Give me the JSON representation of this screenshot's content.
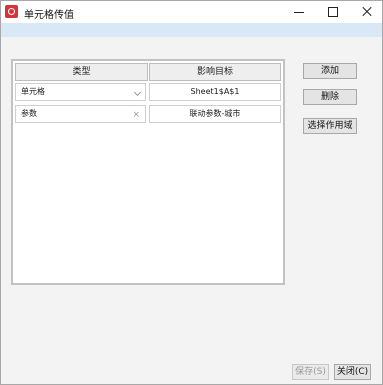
{
  "window": {
    "title": "单元格传值"
  },
  "table": {
    "headers": [
      "类型",
      "影响目标"
    ],
    "rows": [
      {
        "type": "单元格",
        "target": "Sheet1$A$1"
      },
      {
        "type": "参数",
        "target": "联动参数-城市"
      }
    ]
  },
  "side_buttons": {
    "add": "添加",
    "delete": "删除",
    "scope": "选择作用域"
  },
  "footer": {
    "save": "保存(S)",
    "close": "关闭(C)"
  },
  "icons": [
    "app-icon",
    "minimize-icon",
    "maximize-icon",
    "close-icon",
    "dropdown-chevron-icon",
    "clear-icon"
  ],
  "colors": {
    "app_icon": "#d4343a",
    "infobar": "#d9e8f6"
  }
}
